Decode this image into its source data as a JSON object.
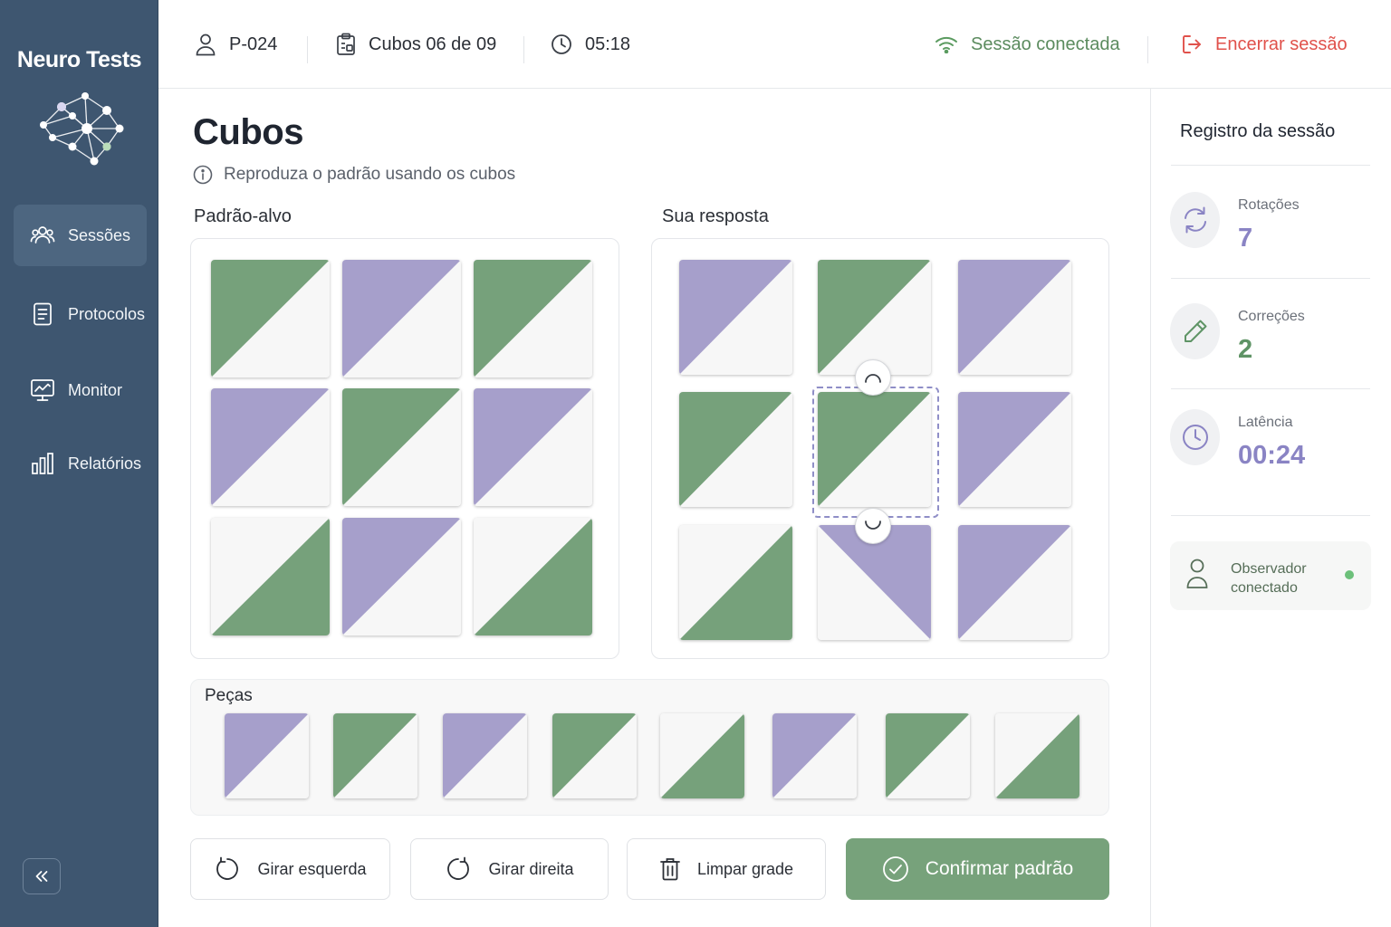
{
  "app": {
    "brand": "Neuro Tests"
  },
  "sidebar": {
    "items": [
      {
        "label": "Sessões",
        "icon": "users-icon",
        "active": true
      },
      {
        "label": "Protocolos",
        "icon": "document-icon",
        "active": false
      },
      {
        "label": "Monitor",
        "icon": "monitor-icon",
        "active": false
      },
      {
        "label": "Relatórios",
        "icon": "bar-chart-icon",
        "active": false
      }
    ],
    "collapse_icon": "double-chevron-left-icon"
  },
  "topbar": {
    "participant": "P-024",
    "task": "Cubos 06 de 09",
    "timer": "05:18",
    "connection": "Sessão conectada",
    "end_session": "Encerrar sessão"
  },
  "main": {
    "title": "Cubos",
    "instruction": "Reproduza o padrão usando os cubos",
    "target_label": "Padrão-alvo",
    "response_label": "Sua resposta",
    "pieces_label": "Peças",
    "target_grid": [
      [
        "green-tl",
        "purple-tl",
        "green-tl"
      ],
      [
        "purple-tl",
        "green-tl",
        "purple-tl"
      ],
      [
        "green-br",
        "purple-tl",
        "green-br"
      ]
    ],
    "response_grid": [
      [
        "purple-tl",
        "green-tl",
        "purple-tl"
      ],
      [
        "green-tl",
        "green-tl",
        "purple-tl"
      ],
      [
        "green-br",
        "purple-tr",
        "purple-tl"
      ]
    ],
    "selected_cell": {
      "row": 1,
      "col": 1
    },
    "pieces": [
      "purple-tl",
      "green-tl",
      "purple-tl",
      "green-tl",
      "green-br",
      "purple-tl",
      "green-tl",
      "green-br"
    ],
    "buttons": {
      "rotate_left": "Girar esquerda",
      "rotate_right": "Girar direita",
      "clear": "Limpar grade",
      "confirm": "Confirmar padrão"
    }
  },
  "session_log": {
    "title": "Registro da sessão",
    "stats": [
      {
        "label": "Rotações",
        "value": "7",
        "icon": "refresh-icon",
        "color": "#8a84c4"
      },
      {
        "label": "Correções",
        "value": "2",
        "icon": "pencil-icon",
        "color": "#5f9466"
      },
      {
        "label": "Latência",
        "value": "00:24",
        "icon": "clock-icon",
        "color": "#8a84c4"
      }
    ],
    "observer": "Observador conectado",
    "observer_status_color": "#6cc07a"
  },
  "colors": {
    "green": "#76a17b",
    "purple": "#a69fcb",
    "tile_bg": "#f7f7f7",
    "sidebar": "#3e5670",
    "accent_red": "#e0514b"
  }
}
